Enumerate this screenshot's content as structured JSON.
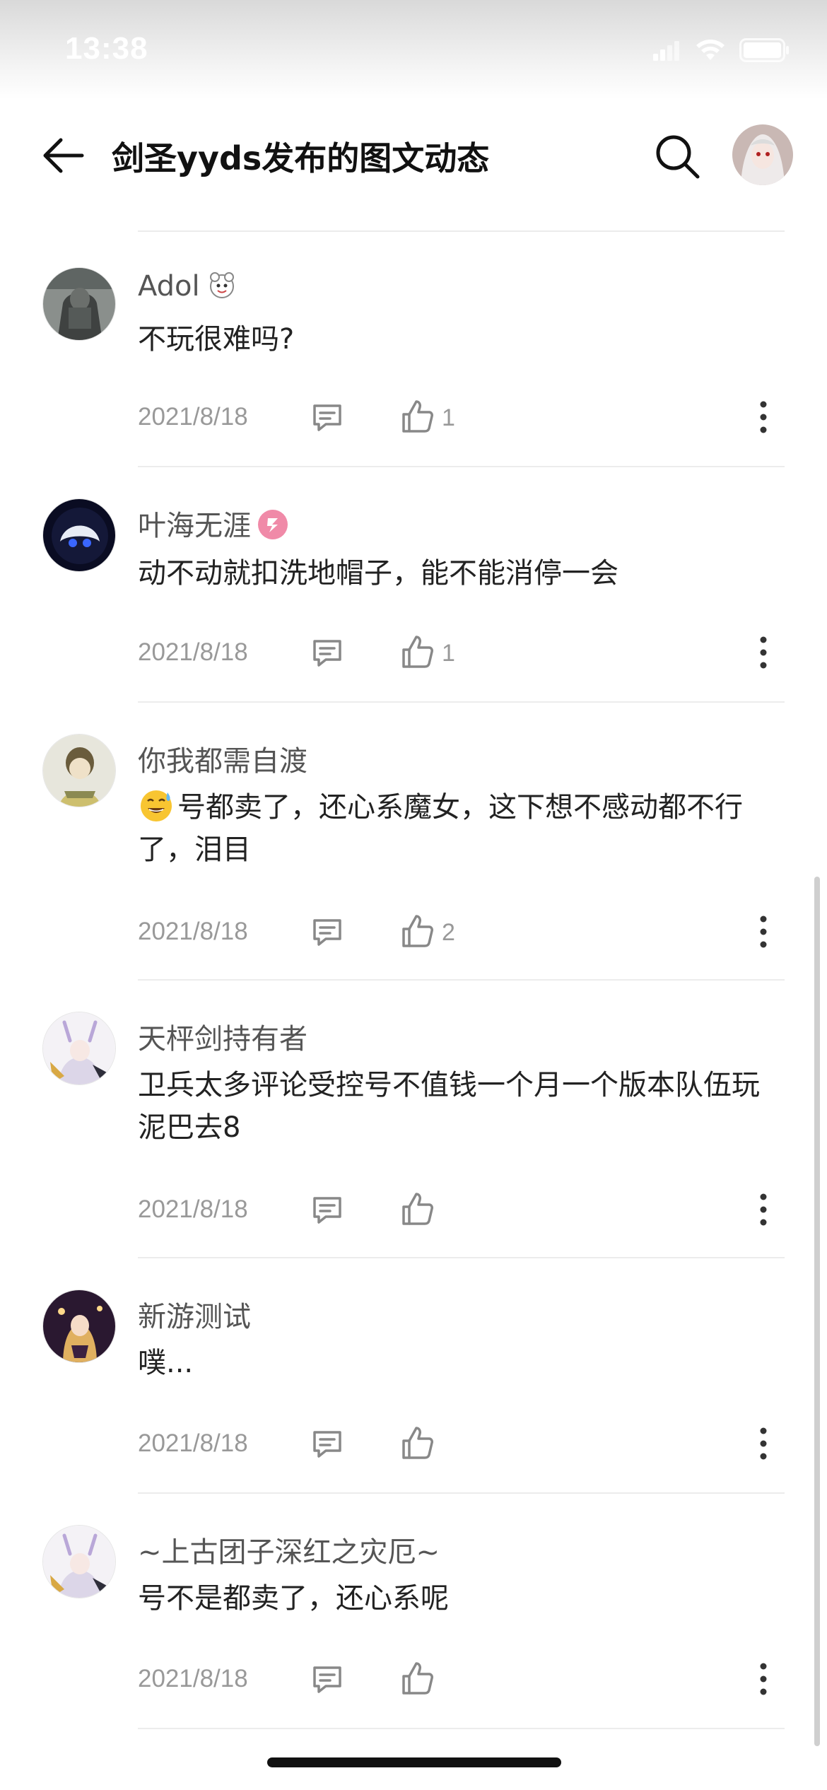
{
  "status_bar": {
    "time": "13:38"
  },
  "header": {
    "title": "剑圣yyds发布的图文动态"
  },
  "comments": [
    {
      "name": "Adol",
      "text": "不玩很难吗?",
      "date": "2021/8/18",
      "likes": "1"
    },
    {
      "name": "叶海无涯",
      "text": "动不动就扣洗地帽子，能不能消停一会",
      "date": "2021/8/18",
      "likes": "1"
    },
    {
      "name": "你我都需自渡",
      "text": "号都卖了，还心系魔女，这下想不感动都不行了，泪目",
      "date": "2021/8/18",
      "likes": "2"
    },
    {
      "name": "天枰剑持有者",
      "text": "卫兵太多评论受控号不值钱一个月一个版本队伍玩泥巴去8",
      "date": "2021/8/18",
      "likes": ""
    },
    {
      "name": "新游测试",
      "text": "噗...",
      "date": "2021/8/18",
      "likes": ""
    },
    {
      "name": "~上古团子深红之灾厄~",
      "text": "号不是都卖了，还心系呢",
      "date": "2021/8/18",
      "likes": ""
    }
  ],
  "icons": {
    "back": "arrow-left-icon",
    "search": "search-icon",
    "reply": "comment-icon",
    "like": "thumbs-up-icon",
    "more": "more-vertical-icon"
  },
  "colors": {
    "meta_text": "#999999",
    "name_text": "#555555",
    "body_text": "#222222",
    "divider": "#ececec"
  }
}
